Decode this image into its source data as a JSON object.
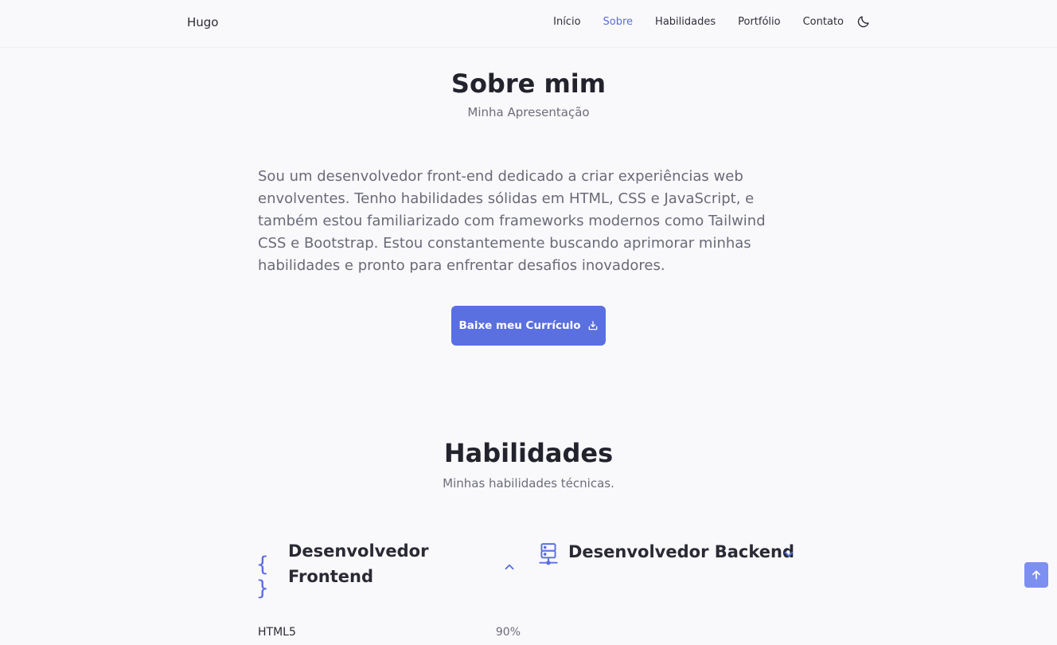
{
  "header": {
    "logo": "Hugo",
    "nav": [
      "Início",
      "Sobre",
      "Habilidades",
      "Portfólio",
      "Contato"
    ]
  },
  "about": {
    "title": "Sobre mim",
    "subtitle": "Minha Apresentação",
    "text": "Sou um desenvolvedor front-end dedicado a criar experiências web envolventes. Tenho habilidades sólidas em HTML, CSS e JavaScript, e também estou familiarizado com frameworks modernos como Tailwind CSS e Bootstrap. Estou constantemente buscando aprimorar minhas habilidades e pronto para enfrentar desafios inovadores.",
    "button": "Baixe meu Currículo"
  },
  "skills": {
    "title": "Habilidades",
    "subtitle": "Minhas habilidades técnicas.",
    "frontend": {
      "title_line1": "Desenvolvedor",
      "title_line2": "Frontend",
      "items": [
        {
          "name": "HTML5",
          "percent": "90%"
        }
      ]
    },
    "backend": {
      "title": "Desenvolvedor Backend"
    }
  },
  "colors": {
    "accent": "#5a6fe0",
    "active_nav": "#5a6be0"
  }
}
